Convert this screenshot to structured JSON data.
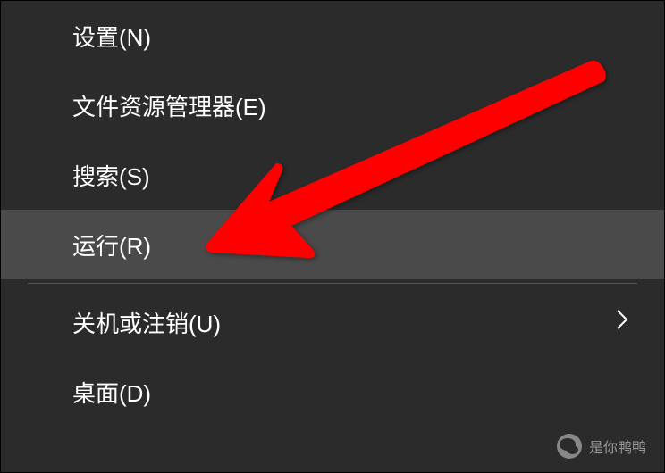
{
  "menu": {
    "items": [
      {
        "label": "设置(N)",
        "highlighted": false,
        "hasSubmenu": false
      },
      {
        "label": "文件资源管理器(E)",
        "highlighted": false,
        "hasSubmenu": false
      },
      {
        "label": "搜索(S)",
        "highlighted": false,
        "hasSubmenu": false
      },
      {
        "label": "运行(R)",
        "highlighted": true,
        "hasSubmenu": false
      },
      {
        "label": "关机或注销(U)",
        "highlighted": false,
        "hasSubmenu": true
      },
      {
        "label": "桌面(D)",
        "highlighted": false,
        "hasSubmenu": false
      }
    ]
  },
  "annotation": {
    "arrow_color": "#ff0000"
  },
  "watermark": {
    "text": "是你鸭鸭"
  }
}
